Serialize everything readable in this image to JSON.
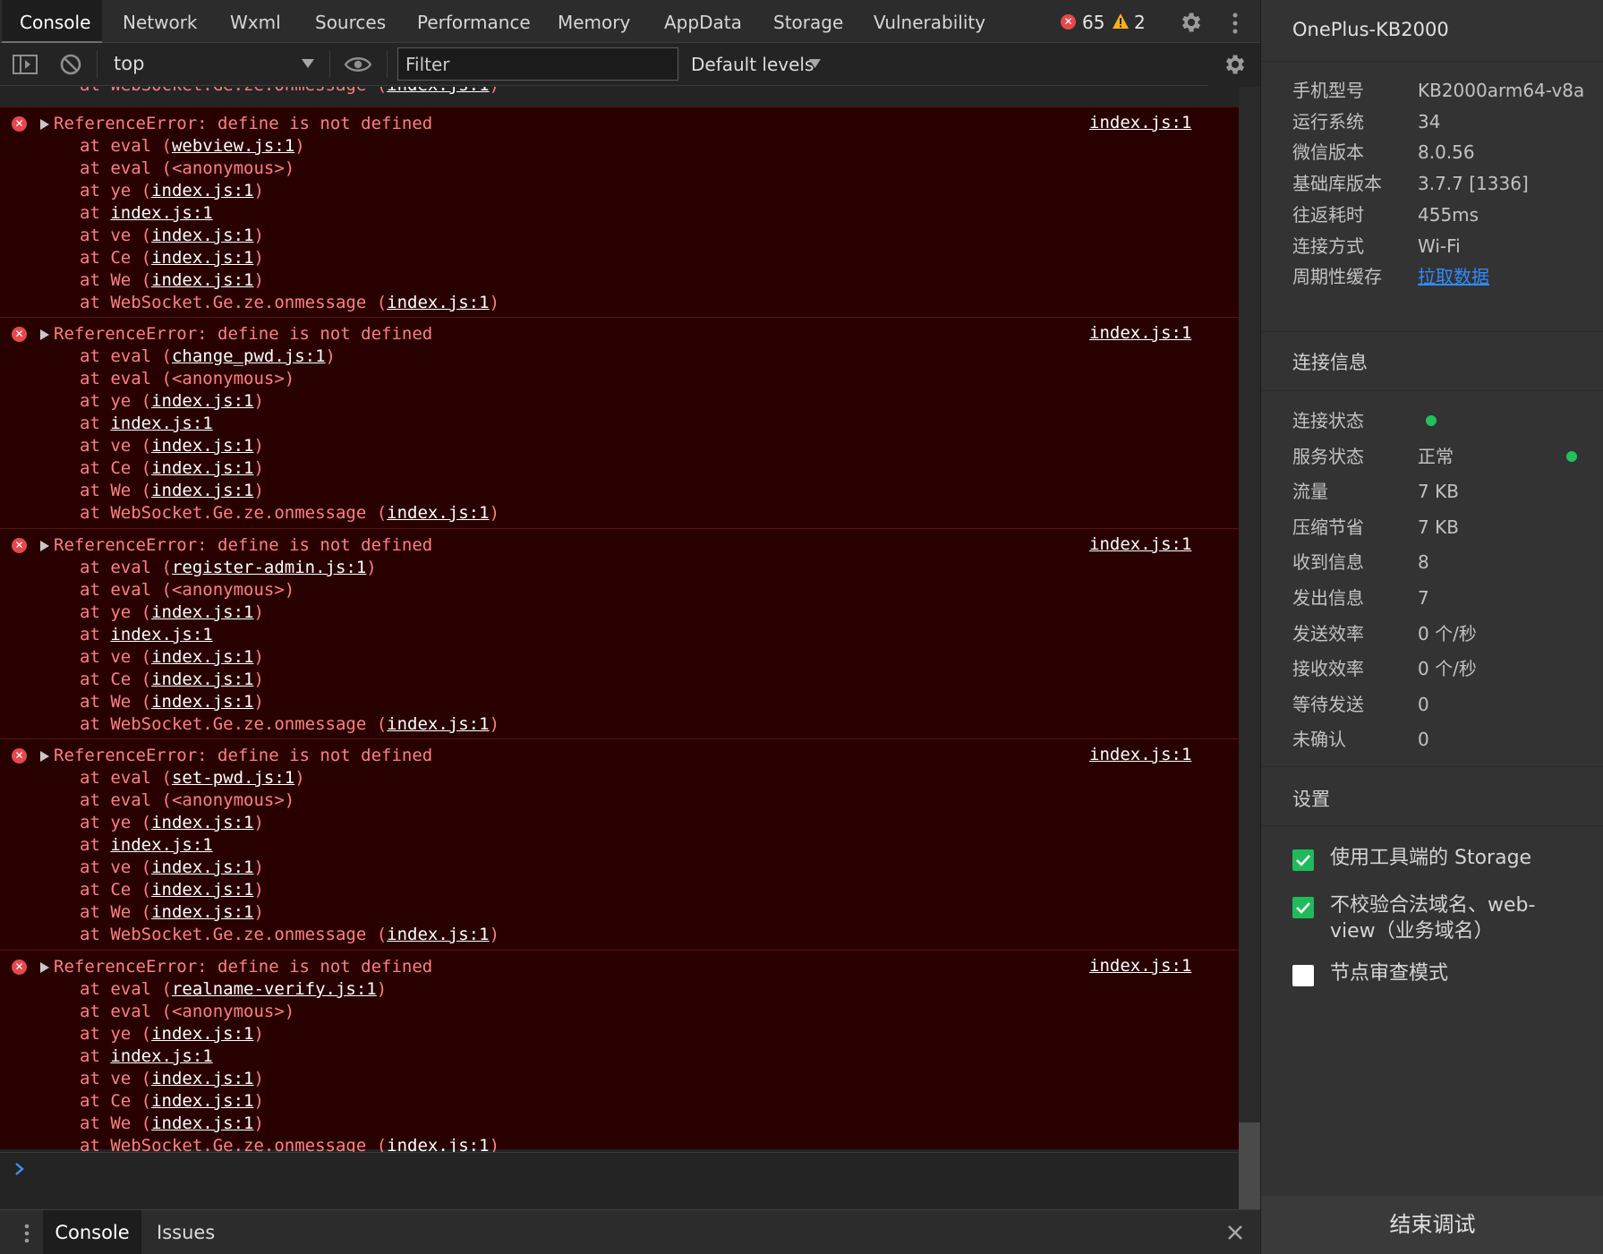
{
  "tabs": {
    "console": "Console",
    "network": "Network",
    "wxml": "Wxml",
    "sources": "Sources",
    "performance": "Performance",
    "memory": "Memory",
    "appdata": "AppData",
    "storage": "Storage",
    "vulnerability": "Vulnerability"
  },
  "badges": {
    "errors": "65",
    "warnings": "2"
  },
  "toolbar": {
    "context": "top",
    "filter_placeholder": "Filter",
    "levels": "Default levels"
  },
  "clipped_line": {
    "prefix": "at WebSocket.Ge.ze.onmessage (",
    "link": "index.js:1",
    "suffix": ")"
  },
  "errors": [
    {
      "message": "ReferenceError: define is not defined",
      "source": "index.js:1",
      "frames": [
        {
          "pre": "at eval (",
          "link": "webview.js:1",
          "post": ")"
        },
        {
          "pre": "at eval (<anonymous>)",
          "link": "",
          "post": ""
        },
        {
          "pre": "at ye (",
          "link": "index.js:1",
          "post": ")"
        },
        {
          "pre": "at ",
          "link": "index.js:1",
          "post": ""
        },
        {
          "pre": "at ve (",
          "link": "index.js:1",
          "post": ")"
        },
        {
          "pre": "at Ce (",
          "link": "index.js:1",
          "post": ")"
        },
        {
          "pre": "at We (",
          "link": "index.js:1",
          "post": ")"
        },
        {
          "pre": "at WebSocket.Ge.ze.onmessage (",
          "link": "index.js:1",
          "post": ")"
        }
      ]
    },
    {
      "message": "ReferenceError: define is not defined",
      "source": "index.js:1",
      "frames": [
        {
          "pre": "at eval (",
          "link": "change_pwd.js:1",
          "post": ")"
        },
        {
          "pre": "at eval (<anonymous>)",
          "link": "",
          "post": ""
        },
        {
          "pre": "at ye (",
          "link": "index.js:1",
          "post": ")"
        },
        {
          "pre": "at ",
          "link": "index.js:1",
          "post": ""
        },
        {
          "pre": "at ve (",
          "link": "index.js:1",
          "post": ")"
        },
        {
          "pre": "at Ce (",
          "link": "index.js:1",
          "post": ")"
        },
        {
          "pre": "at We (",
          "link": "index.js:1",
          "post": ")"
        },
        {
          "pre": "at WebSocket.Ge.ze.onmessage (",
          "link": "index.js:1",
          "post": ")"
        }
      ]
    },
    {
      "message": "ReferenceError: define is not defined",
      "source": "index.js:1",
      "frames": [
        {
          "pre": "at eval (",
          "link": "register-admin.js:1",
          "post": ")"
        },
        {
          "pre": "at eval (<anonymous>)",
          "link": "",
          "post": ""
        },
        {
          "pre": "at ye (",
          "link": "index.js:1",
          "post": ")"
        },
        {
          "pre": "at ",
          "link": "index.js:1",
          "post": ""
        },
        {
          "pre": "at ve (",
          "link": "index.js:1",
          "post": ")"
        },
        {
          "pre": "at Ce (",
          "link": "index.js:1",
          "post": ")"
        },
        {
          "pre": "at We (",
          "link": "index.js:1",
          "post": ")"
        },
        {
          "pre": "at WebSocket.Ge.ze.onmessage (",
          "link": "index.js:1",
          "post": ")"
        }
      ]
    },
    {
      "message": "ReferenceError: define is not defined",
      "source": "index.js:1",
      "frames": [
        {
          "pre": "at eval (",
          "link": "set-pwd.js:1",
          "post": ")"
        },
        {
          "pre": "at eval (<anonymous>)",
          "link": "",
          "post": ""
        },
        {
          "pre": "at ye (",
          "link": "index.js:1",
          "post": ")"
        },
        {
          "pre": "at ",
          "link": "index.js:1",
          "post": ""
        },
        {
          "pre": "at ve (",
          "link": "index.js:1",
          "post": ")"
        },
        {
          "pre": "at Ce (",
          "link": "index.js:1",
          "post": ")"
        },
        {
          "pre": "at We (",
          "link": "index.js:1",
          "post": ")"
        },
        {
          "pre": "at WebSocket.Ge.ze.onmessage (",
          "link": "index.js:1",
          "post": ")"
        }
      ]
    },
    {
      "message": "ReferenceError: define is not defined",
      "source": "index.js:1",
      "frames": [
        {
          "pre": "at eval (",
          "link": "realname-verify.js:1",
          "post": ")"
        },
        {
          "pre": "at eval (<anonymous>)",
          "link": "",
          "post": ""
        },
        {
          "pre": "at ye (",
          "link": "index.js:1",
          "post": ")"
        },
        {
          "pre": "at ",
          "link": "index.js:1",
          "post": ""
        },
        {
          "pre": "at ve (",
          "link": "index.js:1",
          "post": ")"
        },
        {
          "pre": "at Ce (",
          "link": "index.js:1",
          "post": ")"
        },
        {
          "pre": "at We (",
          "link": "index.js:1",
          "post": ")"
        },
        {
          "pre": "at WebSocket.Ge.ze.onmessage (",
          "link": "index.js:1",
          "post": ")"
        }
      ]
    }
  ],
  "drawer": {
    "console": "Console",
    "issues": "Issues"
  },
  "device": {
    "title": "OnePlus-KB2000",
    "rows": [
      {
        "key": "手机型号",
        "value": "KB2000arm64-v8a"
      },
      {
        "key": "运行系统",
        "value": "34"
      },
      {
        "key": "微信版本",
        "value": "8.0.56"
      },
      {
        "key": "基础库版本",
        "value": "3.7.7 [1336]"
      },
      {
        "key": "往返耗时",
        "value": "455ms"
      },
      {
        "key": "连接方式",
        "value": "Wi-Fi"
      },
      {
        "key": "周期性缓存",
        "value": "拉取数据"
      }
    ]
  },
  "connection": {
    "title": "连接信息",
    "rows": [
      {
        "key": "连接状态",
        "value": ""
      },
      {
        "key": "服务状态",
        "value": "正常"
      },
      {
        "key": "流量",
        "value": "7 KB"
      },
      {
        "key": "压缩节省",
        "value": "7 KB"
      },
      {
        "key": "收到信息",
        "value": "8"
      },
      {
        "key": "发出信息",
        "value": "7"
      },
      {
        "key": "发送效率",
        "value": "0 个/秒"
      },
      {
        "key": "接收效率",
        "value": "0 个/秒"
      },
      {
        "key": "等待发送",
        "value": "0"
      },
      {
        "key": "未确认",
        "value": "0"
      }
    ]
  },
  "settings": {
    "title": "设置",
    "options": [
      {
        "label": "使用工具端的 Storage",
        "checked": true
      },
      {
        "label": "不校验合法域名、web-view（业务域名）",
        "checked": true
      },
      {
        "label": "节点审查模式",
        "checked": false
      }
    ]
  },
  "end_debug": "结束调试",
  "colors": {
    "error_text": "#ff8080",
    "error_bg": "#290000",
    "link_blue": "#2f8bff",
    "status_green": "#1ec25f",
    "checkbox_green": "#1fba59"
  }
}
